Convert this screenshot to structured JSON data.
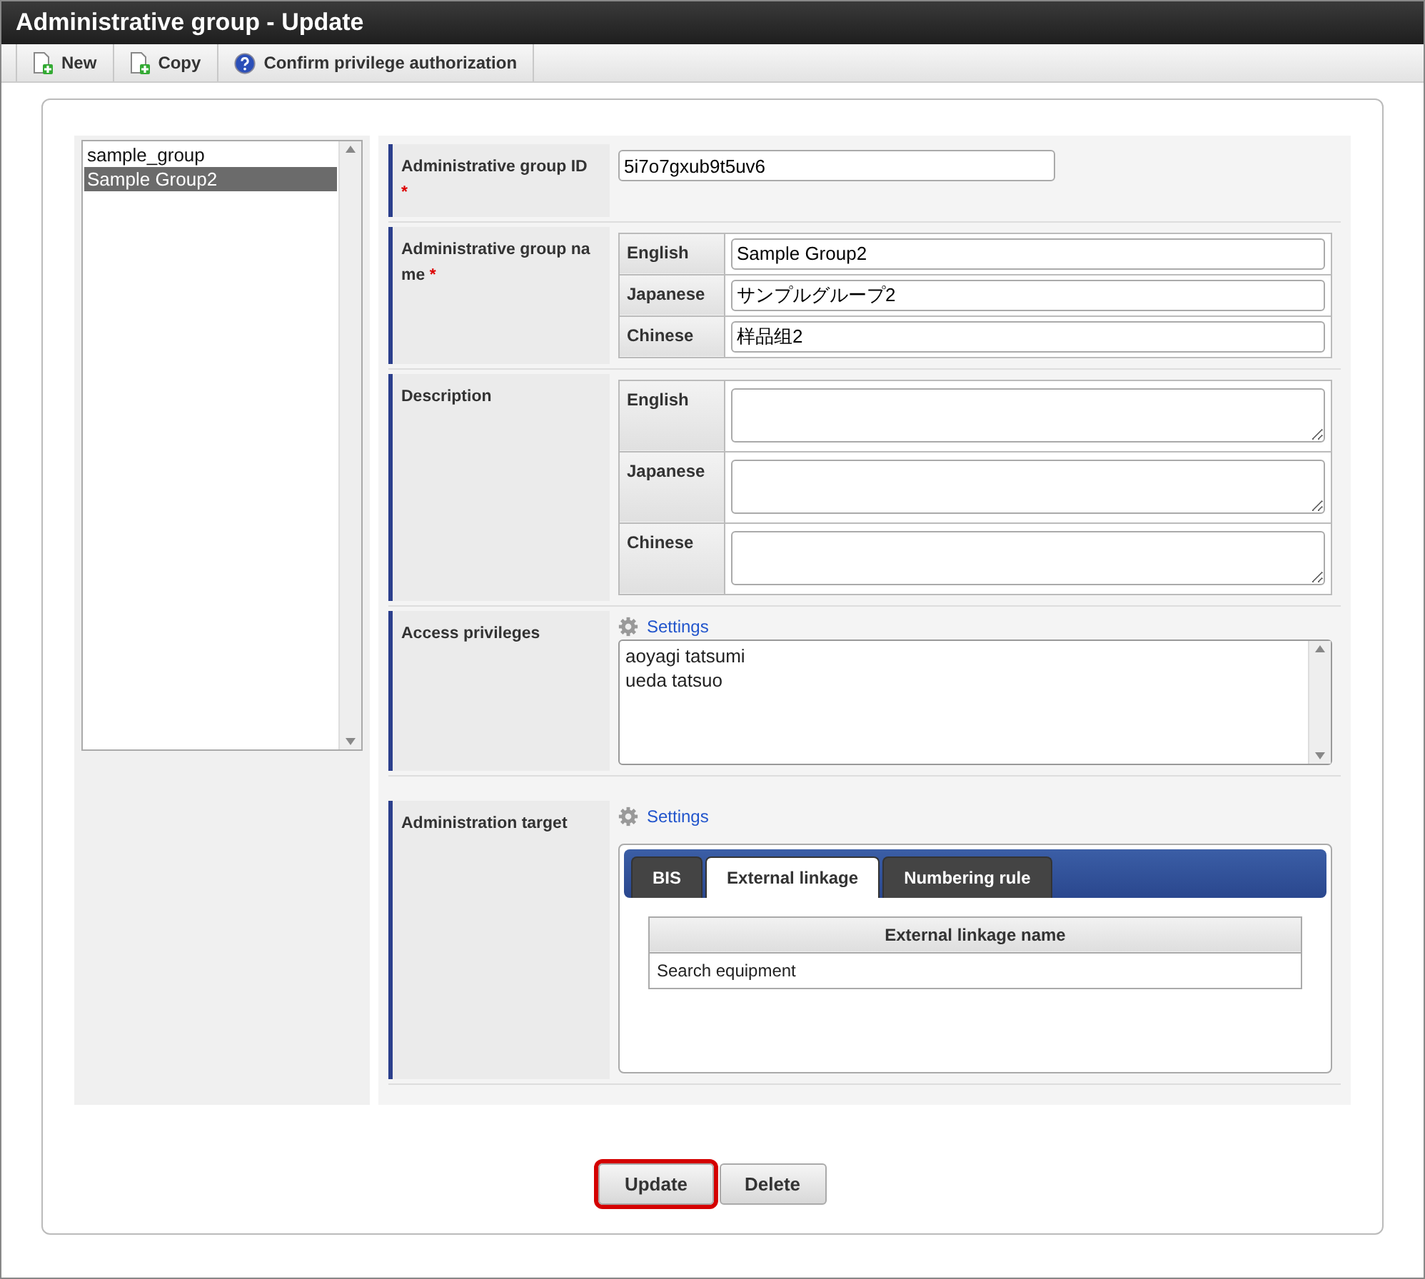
{
  "window": {
    "title": "Administrative group - Update"
  },
  "toolbar": [
    {
      "label": "New",
      "kind": "new"
    },
    {
      "label": "Copy",
      "kind": "copy"
    },
    {
      "label": "Confirm privilege authorization",
      "kind": "help"
    }
  ],
  "group_list": [
    {
      "label": "sample_group",
      "selected": false
    },
    {
      "label": "Sample Group2",
      "selected": true
    }
  ],
  "form": {
    "group_id": {
      "label": "Administrative group ID",
      "required": "*",
      "value": "5i7o7gxub9t5uv6"
    },
    "group_name": {
      "label": "Administrative group na me",
      "required": "*",
      "fields": [
        {
          "language": "English",
          "value": "Sample Group2"
        },
        {
          "language": "Japanese",
          "value": "サンプルグループ2"
        },
        {
          "language": "Chinese",
          "value": "样品组2"
        }
      ]
    },
    "description": {
      "label": "Description",
      "fields": [
        {
          "language": "English"
        },
        {
          "language": "Japanese"
        },
        {
          "language": "Chinese"
        }
      ]
    },
    "access_privileges": {
      "label": "Access privileges",
      "settings_link": "Settings",
      "users": [
        "aoyagi tatsumi",
        "ueda tatsuo"
      ]
    },
    "administration_target": {
      "label": "Administration target",
      "settings_link": "Settings",
      "tabs": [
        {
          "label": "BIS",
          "selected": false
        },
        {
          "label": "External linkage",
          "selected": true
        },
        {
          "label": "Numbering rule",
          "selected": false
        }
      ],
      "table": {
        "columns": [
          "External linkage name"
        ],
        "rows": [
          [
            "Search equipment"
          ]
        ]
      }
    }
  },
  "buttons": [
    {
      "label": "Update",
      "highlighted": true
    },
    {
      "label": "Delete",
      "highlighted": false
    }
  ]
}
